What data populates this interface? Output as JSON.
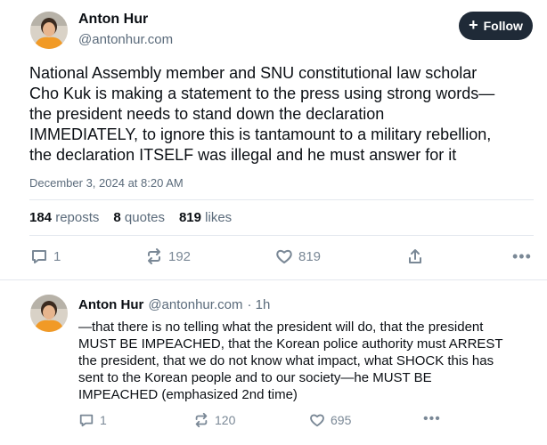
{
  "post": {
    "author_name": "Anton Hur",
    "author_handle": "@antonhur.com",
    "follow_label": "Follow",
    "text_lines": [
      "National Assembly member and SNU constitutional law scholar",
      "Cho Kuk is making a statement to the press using strong words—",
      "the president needs to stand down the declaration",
      "IMMEDIATELY, to ignore this is tantamount to a military rebellion,",
      "the declaration ITSELF was illegal and he must answer for it"
    ],
    "timestamp": "December 3, 2024 at 8:20 AM",
    "stats": {
      "reposts_count": "184",
      "reposts_label": "reposts",
      "quotes_count": "8",
      "quotes_label": "quotes",
      "likes_count": "819",
      "likes_label": "likes"
    },
    "actions": {
      "reply_count": "1",
      "repost_count": "192",
      "like_count": "819"
    }
  },
  "reply": {
    "author_name": "Anton Hur",
    "author_handle": "@antonhur.com",
    "time_ago": "· 1h",
    "text_lines": [
      "—that there is no telling what the president will do, that the president",
      "MUST BE IMPEACHED, that the Korean police authority must ARREST",
      "the president, that we do not know what impact, what SHOCK this has",
      "sent to the Korean people and to our society—he MUST BE",
      "IMPEACHED (emphasized 2nd time)"
    ],
    "actions": {
      "reply_count": "1",
      "repost_count": "120",
      "like_count": "695"
    }
  },
  "icons": [
    "avatar",
    "plus-icon",
    "reply-icon",
    "repost-icon",
    "like-icon",
    "share-icon",
    "more-icon"
  ]
}
